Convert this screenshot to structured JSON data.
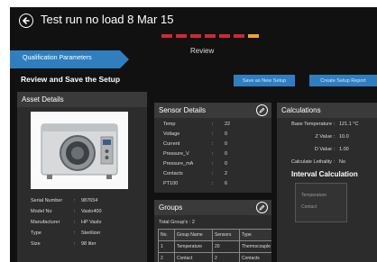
{
  "header": {
    "title": "Test run no load 8 Mar 15"
  },
  "progress": {
    "segments": 7,
    "current_index": 6,
    "step_label": "Review"
  },
  "stage": {
    "label": "Qualification Parameters"
  },
  "page": {
    "subtitle": "Review and Save the Setup"
  },
  "actions": {
    "save_label": "Save as New Setup",
    "report_label": "Create Setup Report"
  },
  "asset": {
    "title": "Asset Details",
    "rows": [
      {
        "key": "Serial Number",
        "value": "987654"
      },
      {
        "key": "Model No",
        "value": "Vaslo400"
      },
      {
        "key": "Manufacturer",
        "value": "HP Vaslo"
      },
      {
        "key": "Type",
        "value": "Sterilizer"
      },
      {
        "key": "Size",
        "value": "98 liter"
      }
    ]
  },
  "sensor": {
    "title": "Sensor Details",
    "rows": [
      {
        "key": "Temp",
        "value": "22"
      },
      {
        "key": "Voltage",
        "value": "0"
      },
      {
        "key": "Current",
        "value": "0"
      },
      {
        "key": "Pressure_V",
        "value": "0"
      },
      {
        "key": "Pressure_mA",
        "value": "0"
      },
      {
        "key": "Contacts",
        "value": "2"
      },
      {
        "key": "PT100",
        "value": "6"
      }
    ]
  },
  "groups": {
    "title": "Groups",
    "total_label": "Total Group's : 2",
    "columns": [
      "No.",
      "Group Name",
      "Sensors",
      "Type"
    ],
    "rows": [
      [
        "1",
        "Temperature",
        "20",
        "Thermocouple"
      ],
      [
        "2",
        "Contact",
        "2",
        "Contacts"
      ]
    ]
  },
  "calculations": {
    "title": "Calculations",
    "rows": [
      {
        "key": "Base Temperature",
        "value": "121.1 °C"
      },
      {
        "key": "Z Value",
        "value": "10.0"
      },
      {
        "key": "D Value",
        "value": "1.00"
      },
      {
        "key": "Calculate Lethality",
        "value": "No"
      }
    ],
    "interval_title": "Interval Calculation",
    "interval_items": [
      "Temperature",
      "Contact"
    ]
  },
  "colors": {
    "accent": "#2f7fc0",
    "progress_done": "#d0292e",
    "progress_current": "#f0a623",
    "background": "#111111",
    "panel": "#2c2c2c"
  },
  "icons": {
    "back": "back-arrow-icon",
    "edit": "edit-pencil-icon"
  }
}
